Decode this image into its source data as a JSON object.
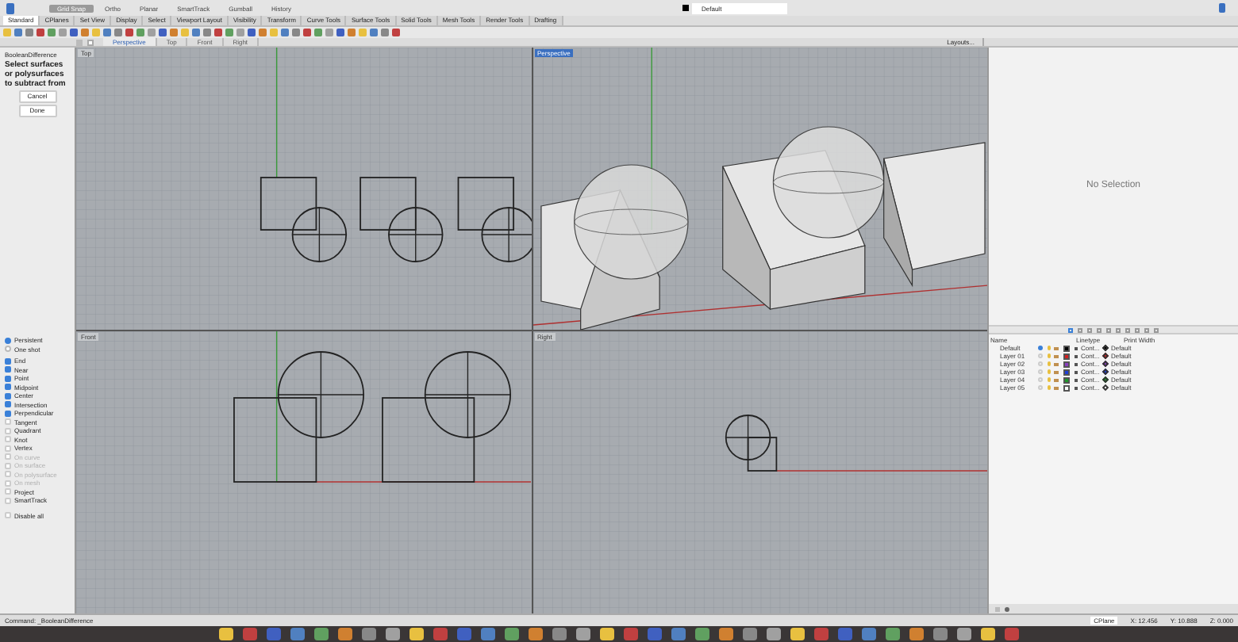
{
  "top_bar": {
    "toggles": [
      {
        "label": "Grid Snap",
        "on": true
      },
      {
        "label": "Ortho",
        "on": false
      },
      {
        "label": "Planar",
        "on": false
      },
      {
        "label": "SmartTrack",
        "on": false
      },
      {
        "label": "Gumball",
        "on": false
      },
      {
        "label": "History",
        "on": false
      }
    ],
    "layer": "Default"
  },
  "toolbar_tabs": [
    {
      "label": "Standard",
      "selected": true
    },
    {
      "label": "CPlanes",
      "selected": false
    },
    {
      "label": "Set View",
      "selected": false
    },
    {
      "label": "Display",
      "selected": false
    },
    {
      "label": "Select",
      "selected": false
    },
    {
      "label": "Viewport Layout",
      "selected": false
    },
    {
      "label": "Visibility",
      "selected": false
    },
    {
      "label": "Transform",
      "selected": false
    },
    {
      "label": "Curve Tools",
      "selected": false
    },
    {
      "label": "Surface Tools",
      "selected": false
    },
    {
      "label": "Solid Tools",
      "selected": false
    },
    {
      "label": "Mesh Tools",
      "selected": false
    },
    {
      "label": "Render Tools",
      "selected": false
    },
    {
      "label": "Drafting",
      "selected": false
    }
  ],
  "viewport_tabs": [
    {
      "label": "Perspective",
      "selected": true
    },
    {
      "label": "Top",
      "selected": false
    },
    {
      "label": "Front",
      "selected": false
    },
    {
      "label": "Right",
      "selected": false
    }
  ],
  "layouts_button": "Layouts...",
  "command_panel": {
    "title": "BooleanDifference",
    "prompt": "Select surfaces or polysurfaces to subtract from",
    "buttons": [
      "Cancel",
      "Done"
    ]
  },
  "osnap": [
    {
      "label": "Persistent",
      "kind": "radio",
      "checked": true,
      "disabled": false
    },
    {
      "label": "One shot",
      "kind": "radio",
      "checked": false,
      "disabled": false
    },
    {
      "label": "End",
      "kind": "check",
      "checked": true,
      "disabled": false
    },
    {
      "label": "Near",
      "kind": "check",
      "checked": true,
      "disabled": false
    },
    {
      "label": "Point",
      "kind": "check",
      "checked": true,
      "disabled": false
    },
    {
      "label": "Midpoint",
      "kind": "check",
      "checked": true,
      "disabled": false
    },
    {
      "label": "Center",
      "kind": "check",
      "checked": true,
      "disabled": false
    },
    {
      "label": "Intersection",
      "kind": "check",
      "checked": true,
      "disabled": false
    },
    {
      "label": "Perpendicular",
      "kind": "check",
      "checked": true,
      "disabled": false
    },
    {
      "label": "Tangent",
      "kind": "check",
      "checked": false,
      "disabled": false
    },
    {
      "label": "Quadrant",
      "kind": "check",
      "checked": false,
      "disabled": false
    },
    {
      "label": "Knot",
      "kind": "check",
      "checked": false,
      "disabled": false
    },
    {
      "label": "Vertex",
      "kind": "check",
      "checked": false,
      "disabled": false
    },
    {
      "label": "On curve",
      "kind": "check",
      "checked": false,
      "disabled": true
    },
    {
      "label": "On surface",
      "kind": "check",
      "checked": false,
      "disabled": true
    },
    {
      "label": "On polysurface",
      "kind": "check",
      "checked": false,
      "disabled": true
    },
    {
      "label": "On mesh",
      "kind": "check",
      "checked": false,
      "disabled": true
    },
    {
      "label": "Project",
      "kind": "check",
      "checked": false,
      "disabled": false
    },
    {
      "label": "SmartTrack",
      "kind": "check",
      "checked": false,
      "disabled": false
    },
    {
      "label": "Disable all",
      "kind": "check",
      "checked": false,
      "disabled": false
    }
  ],
  "viewports": [
    {
      "title": "Top",
      "selected": false,
      "kind": "top"
    },
    {
      "title": "Perspective",
      "selected": true,
      "kind": "perspective"
    },
    {
      "title": "Front",
      "selected": false,
      "kind": "front"
    },
    {
      "title": "Right",
      "selected": false,
      "kind": "right"
    }
  ],
  "properties": {
    "message": "No Selection"
  },
  "layers": {
    "columns": [
      "Name",
      "Linetype",
      "Print Width"
    ],
    "rows": [
      {
        "name": "Default",
        "current": true,
        "color": "#000000",
        "linetype": "Cont...",
        "print_width": "Default"
      },
      {
        "name": "Layer 01",
        "current": false,
        "color": "#d42020",
        "linetype": "Cont...",
        "print_width": "Default"
      },
      {
        "name": "Layer 02",
        "current": false,
        "color": "#8a3fc0",
        "linetype": "Cont...",
        "print_width": "Default"
      },
      {
        "name": "Layer 03",
        "current": false,
        "color": "#1f3fd8",
        "linetype": "Cont...",
        "print_width": "Default"
      },
      {
        "name": "Layer 04",
        "current": false,
        "color": "#1f9a2a",
        "linetype": "Cont...",
        "print_width": "Default"
      },
      {
        "name": "Layer 05",
        "current": false,
        "color": "#ffffff",
        "linetype": "Cont...",
        "print_width": "Default"
      }
    ]
  },
  "status_bar": {
    "command": "Command: _BooleanDifference",
    "cplane": "CPlane",
    "x": "X: 12.456",
    "y": "Y: 10.888",
    "z": "Z: 0.000"
  }
}
